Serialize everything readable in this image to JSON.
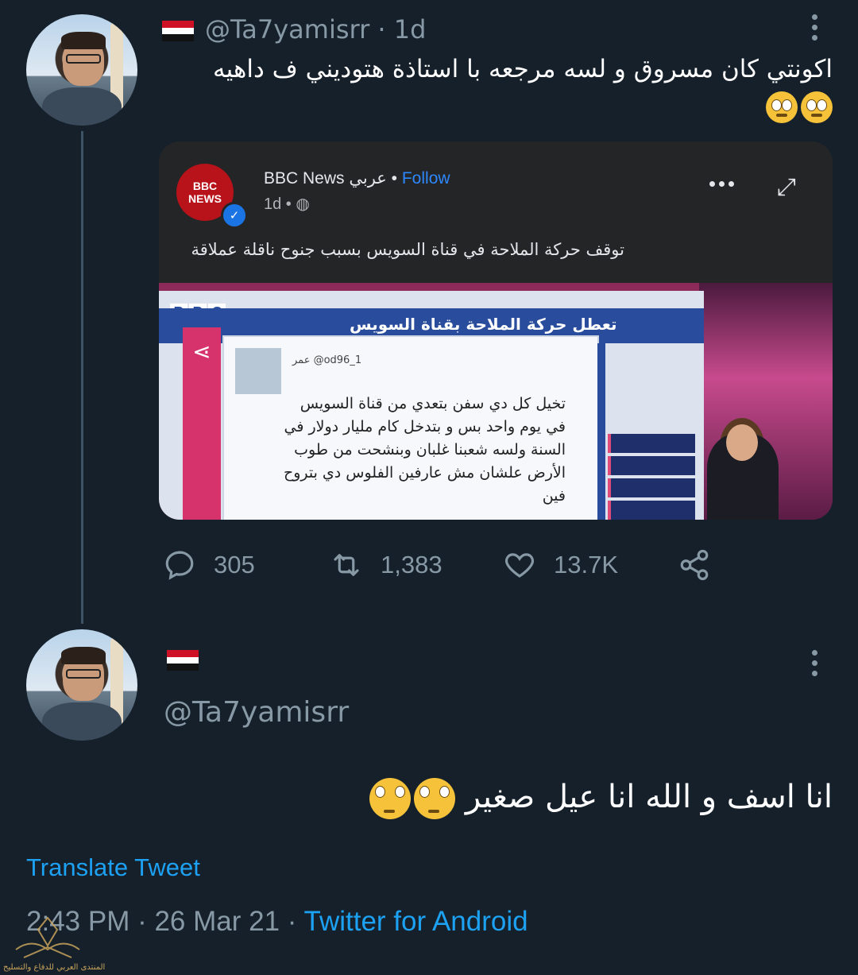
{
  "tweet1": {
    "handle": "@Ta7yamisrr · 1d",
    "text": "اكونتي كان مسروق و لسه مرجعه با استاذة هتوديني ف داهيه",
    "embed": {
      "source_name": "BBC News عربي •",
      "follow_label": "Follow",
      "time": "1d •",
      "logo_text_top": "BBC",
      "logo_text_bottom": "NEWS",
      "headline": "توقف حركة الملاحة في قناة السويس بسبب جنوح ناقلة عملاقة",
      "image": {
        "screen_title": "تعطل حركة الملاحة بقناة السويس",
        "bbc_letters": [
          "B",
          "B",
          "C"
        ],
        "inner_handle": "عمر @od96_1",
        "inner_text": "تخيل كل دي سفن بتعدي من قناة السويس في يوم واحد بس و بتدخل كام مليار دولار في السنة ولسه شعبنا غلبان وبنشحت من طوب الأرض علشان مش عارفين الفلوس دي بتروح فين"
      }
    },
    "stats": {
      "replies": "305",
      "retweets": "1,383",
      "likes": "13.7K"
    }
  },
  "tweet2": {
    "handle": "@Ta7yamisrr",
    "text": "انا اسف و الله انا عيل صغير",
    "translate_label": "Translate Tweet",
    "time": "2:43 PM · 26 Mar 21 · ",
    "source": "Twitter for Android"
  },
  "colors": {
    "background": "#15202b",
    "accent": "#1da1f2",
    "muted": "#8899a6",
    "bbc_red": "#b8121a"
  }
}
